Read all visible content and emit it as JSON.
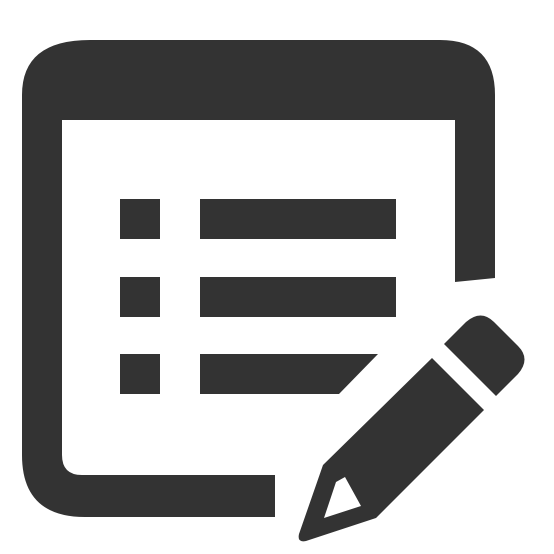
{
  "icon": {
    "semantic": "edit-list-icon",
    "colors": {
      "foreground": "#333333",
      "background": "#ffffff"
    }
  }
}
